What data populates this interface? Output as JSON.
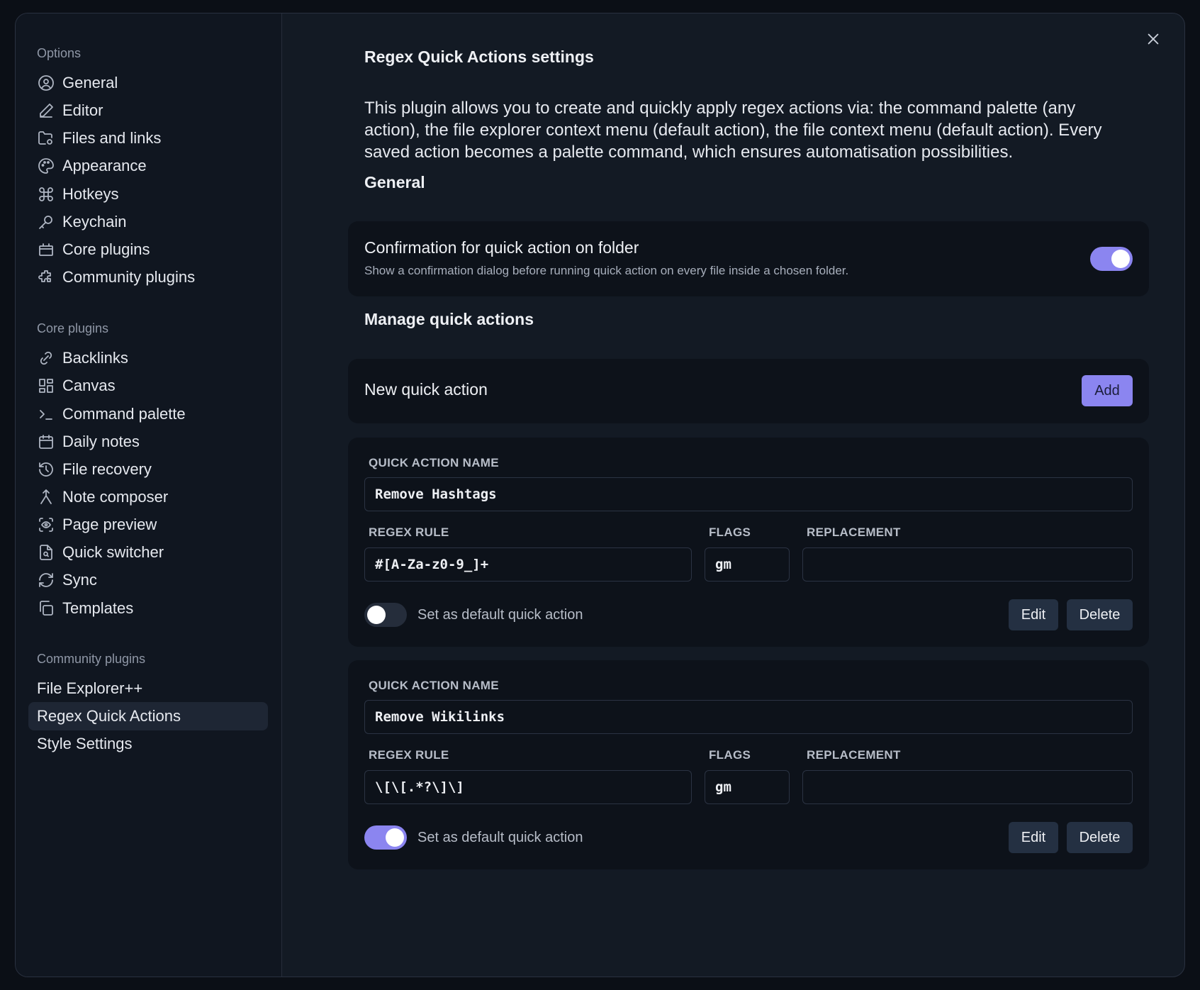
{
  "sidebar": {
    "options_title": "Options",
    "options": [
      {
        "label": "General",
        "icon": "user-circle-icon"
      },
      {
        "label": "Editor",
        "icon": "pencil-icon"
      },
      {
        "label": "Files and links",
        "icon": "folder-cog-icon"
      },
      {
        "label": "Appearance",
        "icon": "palette-icon"
      },
      {
        "label": "Hotkeys",
        "icon": "command-icon"
      },
      {
        "label": "Keychain",
        "icon": "key-icon"
      },
      {
        "label": "Core plugins",
        "icon": "briefcase-icon"
      },
      {
        "label": "Community plugins",
        "icon": "puzzle-icon"
      }
    ],
    "core_title": "Core plugins",
    "core": [
      {
        "label": "Backlinks",
        "icon": "link-search-icon"
      },
      {
        "label": "Canvas",
        "icon": "layout-dashboard-icon"
      },
      {
        "label": "Command palette",
        "icon": "terminal-icon"
      },
      {
        "label": "Daily notes",
        "icon": "calendar-icon"
      },
      {
        "label": "File recovery",
        "icon": "history-icon"
      },
      {
        "label": "Note composer",
        "icon": "merge-icon"
      },
      {
        "label": "Page preview",
        "icon": "scan-eye-icon"
      },
      {
        "label": "Quick switcher",
        "icon": "file-search-icon"
      },
      {
        "label": "Sync",
        "icon": "refresh-icon"
      },
      {
        "label": "Templates",
        "icon": "copy-icon"
      }
    ],
    "community_title": "Community plugins",
    "community": [
      {
        "label": "File Explorer++"
      },
      {
        "label": "Regex Quick Actions"
      },
      {
        "label": "Style Settings"
      }
    ]
  },
  "main": {
    "title": "Regex Quick Actions settings",
    "description": "This plugin allows you to create and quickly apply regex actions via: the command palette (any action), the file explorer context menu (default action), the file context menu (default action). Every saved action becomes a palette command, which ensures automatisation possibilities.",
    "general_heading": "General",
    "confirm_setting": {
      "name": "Confirmation for quick action on folder",
      "desc": "Show a confirmation dialog before running quick action on every file inside a chosen folder.",
      "enabled": true
    },
    "manage_heading": "Manage quick actions",
    "new_action": {
      "label": "New quick action",
      "button": "Add"
    },
    "actions": [
      {
        "name_label": "QUICK ACTION NAME",
        "name": "Remove Hashtags",
        "regex_label": "REGEX RULE",
        "regex": "#[A-Za-z0-9_]+",
        "flags_label": "FLAGS",
        "flags": "gm",
        "replacement_label": "REPLACEMENT",
        "replacement": "",
        "default_label": "Set as default quick action",
        "is_default": false,
        "edit_label": "Edit",
        "delete_label": "Delete"
      },
      {
        "name_label": "QUICK ACTION NAME",
        "name": "Remove Wikilinks",
        "regex_label": "REGEX RULE",
        "regex": "\\[\\[.*?\\]\\]",
        "flags_label": "FLAGS",
        "flags": "gm",
        "replacement_label": "REPLACEMENT",
        "replacement": "",
        "default_label": "Set as default quick action",
        "is_default": true,
        "edit_label": "Edit",
        "delete_label": "Delete"
      }
    ]
  },
  "colors": {
    "accent": "#8b85f0",
    "background": "#131a24",
    "card": "#0d121a"
  }
}
